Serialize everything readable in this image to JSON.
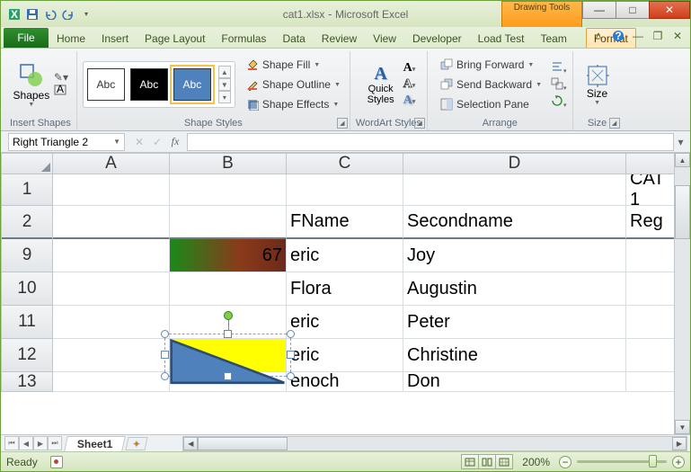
{
  "window": {
    "filename": "cat1.xlsx",
    "app": "Microsoft Excel",
    "context_tab_group": "Drawing Tools"
  },
  "tabs": {
    "file": "File",
    "list": [
      "Home",
      "Insert",
      "Page Layout",
      "Formulas",
      "Data",
      "Review",
      "View",
      "Developer",
      "Load Test",
      "Team"
    ],
    "context": "Format"
  },
  "ribbon": {
    "insert_shapes": {
      "label": "Insert Shapes",
      "shapes_btn": "Shapes"
    },
    "shape_styles": {
      "label": "Shape Styles",
      "swatch_text": "Abc",
      "fill": "Shape Fill",
      "outline": "Shape Outline",
      "effects": "Shape Effects"
    },
    "wordart": {
      "label": "WordArt Styles",
      "quick_styles": "Quick\nStyles"
    },
    "arrange": {
      "label": "Arrange",
      "bring_forward": "Bring Forward",
      "send_backward": "Send Backward",
      "selection_pane": "Selection Pane"
    },
    "size": {
      "label": "Size",
      "btn": "Size"
    }
  },
  "formula_bar": {
    "name_box": "Right Triangle 2",
    "formula": ""
  },
  "grid": {
    "columns": [
      "A",
      "B",
      "C",
      "D"
    ],
    "last_col_text": "",
    "rows": [
      {
        "h": "1",
        "A": "",
        "B": "",
        "C": "",
        "D": "",
        "E": "CAT 1"
      },
      {
        "h": "2",
        "A": "",
        "B": "",
        "C": "FName",
        "D": "Secondname",
        "E": "Reg"
      },
      {
        "h": "9",
        "A": "",
        "B": "67",
        "C": "eric",
        "D": "Joy",
        "E": ""
      },
      {
        "h": "10",
        "A": "",
        "B": "",
        "C": "Flora",
        "D": "Augustin",
        "E": ""
      },
      {
        "h": "11",
        "A": "",
        "B": "",
        "C": "eric",
        "D": "Peter",
        "E": ""
      },
      {
        "h": "12",
        "A": "",
        "B": "",
        "C": "eric",
        "D": "Christine",
        "E": ""
      },
      {
        "h": "13",
        "A": "",
        "B": "",
        "C": "enoch",
        "D": "Don",
        "E": ""
      }
    ]
  },
  "sheet_tabs": {
    "active": "Sheet1"
  },
  "status": {
    "mode": "Ready",
    "zoom": "200%"
  }
}
